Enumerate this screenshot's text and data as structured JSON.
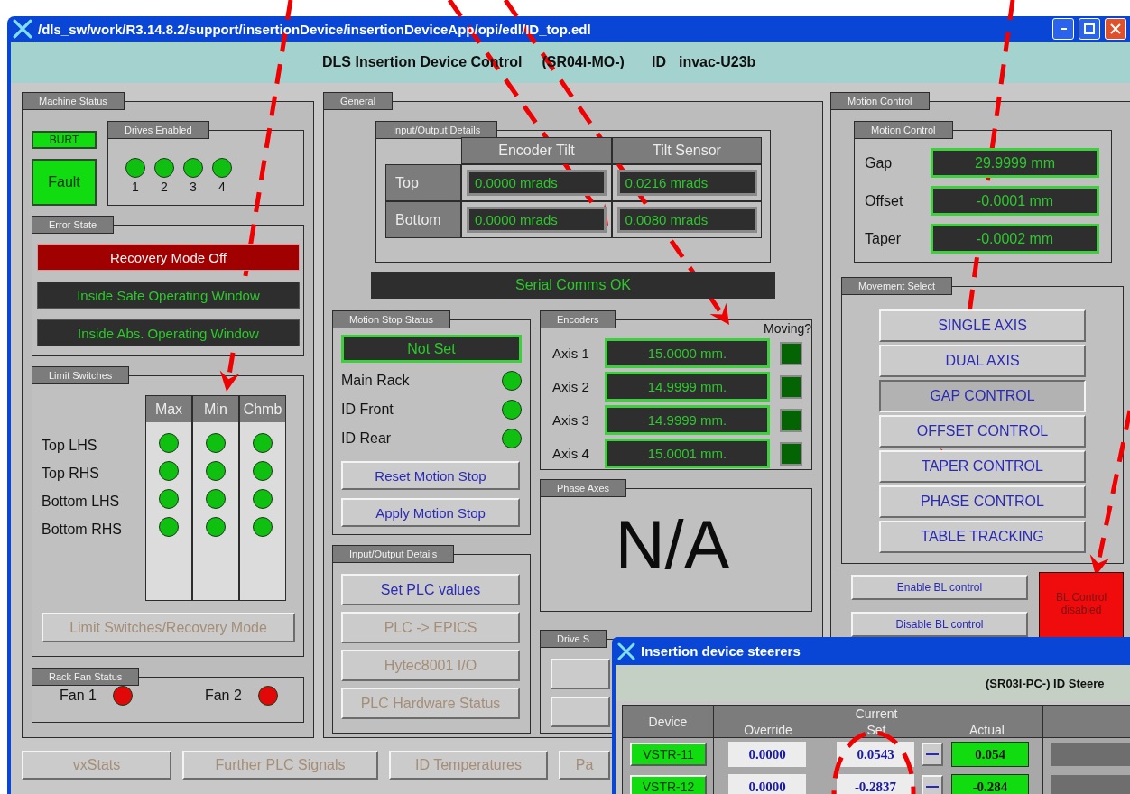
{
  "window": {
    "title": "/dls_sw/work/R3.14.8.2/support/insertionDevice/insertionDeviceApp/opi/edl/ID_top.edl",
    "header": {
      "title": "DLS Insertion Device Control",
      "prefix": "(SR04I-MO-)",
      "id_label": "ID",
      "id_value": "invac-U23b"
    }
  },
  "machine_status": {
    "title": "Machine Status",
    "burt": "BURT",
    "fault": "Fault",
    "drives_enabled": {
      "title": "Drives Enabled",
      "drives": [
        {
          "label": "1",
          "ok": true
        },
        {
          "label": "2",
          "ok": true
        },
        {
          "label": "3",
          "ok": true
        },
        {
          "label": "4",
          "ok": true
        }
      ]
    },
    "error_state": {
      "title": "Error State",
      "indicators": [
        {
          "label": "Recovery Mode Off",
          "kind": "alarm"
        },
        {
          "label": "Inside Safe Operating Window",
          "kind": "ok"
        },
        {
          "label": "Inside Abs. Operating Window",
          "kind": "ok"
        }
      ]
    },
    "limit_switches": {
      "title": "Limit Switches",
      "columns": [
        "Max",
        "Min",
        "Chmb"
      ],
      "rows": [
        {
          "label": "Top LHS",
          "states": [
            true,
            true,
            true
          ]
        },
        {
          "label": "Top RHS",
          "states": [
            true,
            true,
            true
          ]
        },
        {
          "label": "Bottom LHS",
          "states": [
            true,
            true,
            true
          ]
        },
        {
          "label": "Bottom RHS",
          "states": [
            true,
            true,
            true
          ]
        }
      ],
      "button": {
        "label": "Limit Switches/Recovery Mode",
        "disabled": true
      }
    },
    "rack_fan_status": {
      "title": "Rack Fan Status",
      "fans": [
        {
          "label": "Fan 1",
          "ok": false
        },
        {
          "label": "Fan 2",
          "ok": false
        }
      ]
    }
  },
  "general": {
    "title": "General",
    "io_details": {
      "title": "Input/Output Details",
      "columns": [
        "Encoder Tilt",
        "Tilt Sensor"
      ],
      "rows": [
        {
          "label": "Top",
          "values": [
            "0.0000 mrads",
            "0.0216 mrads"
          ]
        },
        {
          "label": "Bottom",
          "values": [
            "0.0000 mrads",
            "0.0080 mrads"
          ]
        }
      ]
    },
    "serial_status": "Serial Comms OK",
    "motion_stop": {
      "title": "Motion Stop Status",
      "status": "Not Set",
      "interlocks": [
        {
          "label": "Main Rack",
          "ok": true
        },
        {
          "label": "ID Front",
          "ok": true
        },
        {
          "label": "ID Rear",
          "ok": true
        }
      ],
      "buttons": [
        {
          "label": "Reset Motion Stop",
          "disabled": false
        },
        {
          "label": "Apply Motion Stop",
          "disabled": false
        }
      ]
    },
    "encoders": {
      "title": "Encoders",
      "moving_label": "Moving?",
      "axes": [
        {
          "label": "Axis 1",
          "value": "15.0000 mm.",
          "moving": false
        },
        {
          "label": "Axis 2",
          "value": "14.9999 mm.",
          "moving": false
        },
        {
          "label": "Axis 3",
          "value": "14.9999 mm.",
          "moving": false
        },
        {
          "label": "Axis 4",
          "value": "15.0001 mm.",
          "moving": false
        }
      ]
    },
    "phase_axes": {
      "title": "Phase Axes",
      "value": "N/A"
    },
    "io_buttons": {
      "title": "Input/Output Details",
      "buttons": [
        {
          "label": "Set PLC values",
          "disabled": false
        },
        {
          "label": "PLC -> EPICS",
          "disabled": true
        },
        {
          "label": "Hytec8001 I/O",
          "disabled": true
        },
        {
          "label": "PLC Hardware Status",
          "disabled": true
        }
      ]
    },
    "drive_status": {
      "title": "Drive S"
    }
  },
  "motion_control": {
    "title": "Motion Control",
    "readbacks": {
      "title": "Motion Control",
      "rows": [
        {
          "label": "Gap",
          "value": "29.9999 mm"
        },
        {
          "label": "Offset",
          "value": "-0.0001 mm"
        },
        {
          "label": "Taper",
          "value": "-0.0002 mm"
        }
      ]
    },
    "movement_select": {
      "title": "Movement Select",
      "modes": [
        {
          "label": "SINGLE AXIS",
          "selected": false
        },
        {
          "label": "DUAL AXIS",
          "selected": false
        },
        {
          "label": "GAP CONTROL",
          "selected": true
        },
        {
          "label": "OFFSET CONTROL",
          "selected": false
        },
        {
          "label": "TAPER CONTROL",
          "selected": false
        },
        {
          "label": "PHASE CONTROL",
          "selected": false
        },
        {
          "label": "TABLE TRACKING",
          "selected": false
        }
      ]
    },
    "bl_buttons": [
      "Enable BL control",
      "Disable BL control"
    ],
    "bl_status": "BL Control disabled"
  },
  "footer_buttons": [
    {
      "label": "vxStats",
      "disabled": true
    },
    {
      "label": "Further PLC Signals",
      "disabled": true
    },
    {
      "label": "ID Temperatures",
      "disabled": true
    },
    {
      "label": "Pa",
      "disabled": true
    }
  ],
  "steerers_window": {
    "title": "Insertion device steerers",
    "header": "(SR03I-PC-) ID Steere",
    "columns": {
      "device": "Device",
      "current": "Current",
      "override": "Override",
      "set": "Set",
      "actual": "Actual"
    },
    "rows": [
      {
        "device": "VSTR-11",
        "override": "0.0000",
        "set": "0.0543",
        "actual": "0.054"
      },
      {
        "device": "VSTR-12",
        "override": "0.0000",
        "set": "-0.2837",
        "actual": "-0.284"
      }
    ]
  }
}
